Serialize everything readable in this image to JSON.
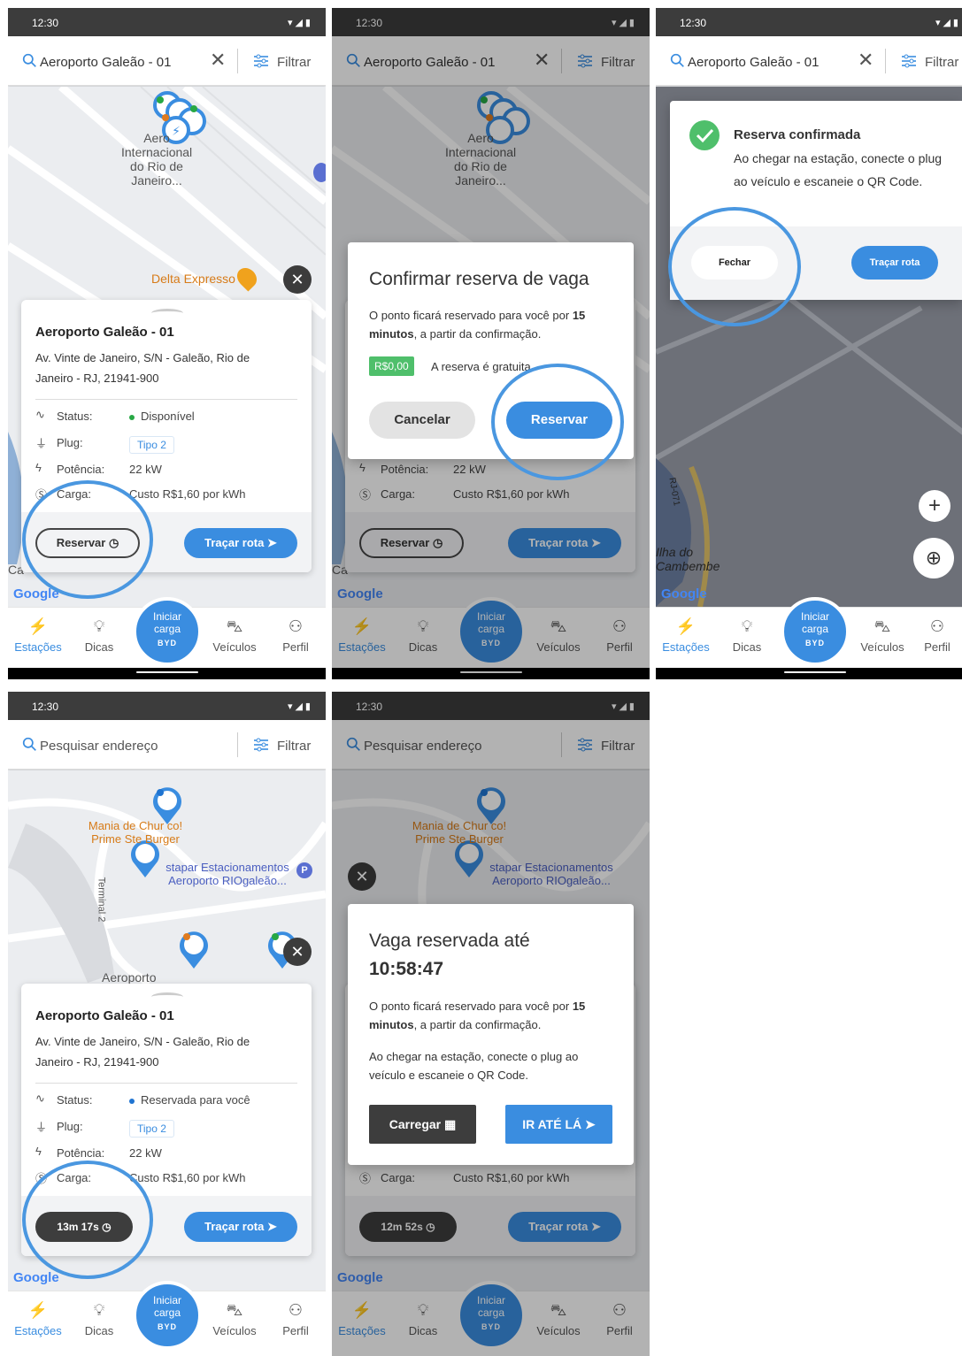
{
  "status_time": "12:30",
  "search_query": "Aeroporto Galeão - 01",
  "search_placeholder": "Pesquisar endereço",
  "filter_label": "Filtrar",
  "nav": {
    "stations": "Estações",
    "tips": "Dicas",
    "center_line1": "Iniciar",
    "center_line2": "carga",
    "center_brand": "BYD",
    "vehicles": "Veículos",
    "profile": "Perfil"
  },
  "map": {
    "airport_label": "Aeroporto Internacional do Rio de Janeiro...",
    "airport_l1": "Aero",
    "airport_l2": "Internacional",
    "airport_l3": "do Rio de",
    "airport_l4": "Janeiro...",
    "delta": "Delta Expresso",
    "ilha1": "Ilha do",
    "ilha2": "Cambembe",
    "rj": "RJ-071",
    "mania1": "Mania de Chur  co!",
    "mania2": "Prime Ste   Burger",
    "estapar1": "stapar Estacionamentos",
    "estapar2": "Aeroporto RIOgaleão...",
    "terminal": "Terminal 2",
    "aeroporto_partial": "Aeroporto",
    "google": "Google",
    "ca": "Ca"
  },
  "station": {
    "name": "Aeroporto Galeão - 01",
    "address": "Av. Vinte de Janeiro, S/N - Galeão, Rio de Janeiro - RJ, 21941-900",
    "status_label": "Status:",
    "status_available": "Disponível",
    "status_reserved": "Reservada para você",
    "plug_label": "Plug:",
    "plug_value": "Tipo 2",
    "power_label": "Potência:",
    "power_value": "22 kW",
    "charge_label": "Carga:",
    "charge_value": "Custo R$1,60 por kWh",
    "reserve_btn": "Reservar",
    "route_btn": "Traçar rota",
    "timer_1": "13m 17s",
    "timer_2": "12m 52s"
  },
  "confirm_dialog": {
    "title": "Confirmar reserva de vaga",
    "text_pre": "O ponto ficará reservado para você por",
    "text_bold": "15 minutos",
    "text_post": ", a partir da confirmação.",
    "price": "R$0,00",
    "price_note": "A reserva é gratuita",
    "cancel": "Cancelar",
    "reserve": "Reservar"
  },
  "confirmed_dialog": {
    "title": "Reserva confirmada",
    "text": "Ao chegar na estação, conecte o plug ao veículo e escaneie o QR Code.",
    "close": "Fechar",
    "route": "Traçar rota"
  },
  "reserved_dialog": {
    "title1": "Vaga reservada até",
    "time": "10:58:47",
    "text_pre": "O ponto ficará reservado para você por",
    "text_bold": "15 minutos",
    "text_post": ", a partir da confirmação.",
    "text2": "Ao chegar na estação, conecte o plug ao veículo e escaneie o QR Code.",
    "charge": "Carregar",
    "go": "IR ATÉ LÁ"
  },
  "colors": {
    "accent": "#3a8de0",
    "available": "#27a844",
    "reserved": "#1f74d1",
    "price_bg": "#4fbf6b"
  }
}
